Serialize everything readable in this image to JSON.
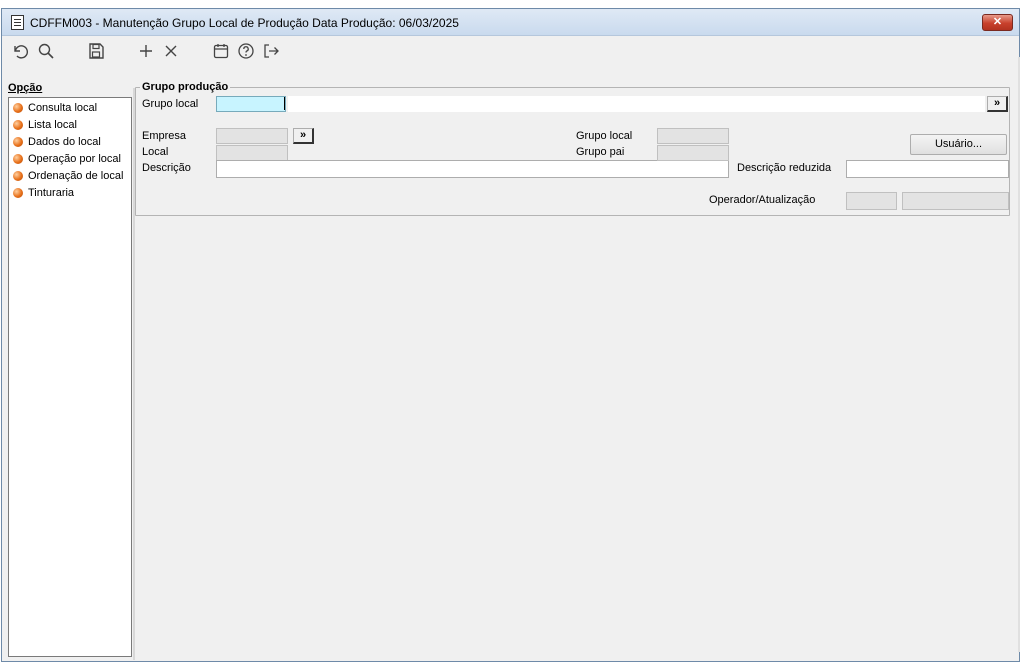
{
  "window": {
    "title": "CDFFM003 - Manutenção Grupo Local de Produção Data Produção: 06/03/2025",
    "close_label": "✕"
  },
  "toolbar": {
    "icons": [
      "undo-icon",
      "search-icon",
      "save-icon",
      "add-icon",
      "delete-icon",
      "calendar-icon",
      "help-icon",
      "exit-icon"
    ]
  },
  "sidebar": {
    "title": "Opção",
    "items": [
      {
        "label": "Consulta local"
      },
      {
        "label": "Lista local"
      },
      {
        "label": "Dados do local"
      },
      {
        "label": "Operação por local"
      },
      {
        "label": "Ordenação de local"
      },
      {
        "label": "Tinturaria"
      }
    ]
  },
  "form": {
    "group_title": "Grupo produção",
    "grupo_local_label": "Grupo local",
    "grupo_local_value": "",
    "empresa_label": "Empresa",
    "local_label": "Local",
    "descricao_label": "Descrição",
    "grupo_local2_label": "Grupo local",
    "grupo_pai_label": "Grupo pai",
    "descricao_reduzida_label": "Descrição reduzida",
    "operador_label": "Operador/Atualização",
    "usuario_button": "Usuário...",
    "lookup_label": "»"
  },
  "colors": {
    "focus_field": "#c8f4ff",
    "bullet": "#e8701a",
    "close": "#c8412c"
  }
}
